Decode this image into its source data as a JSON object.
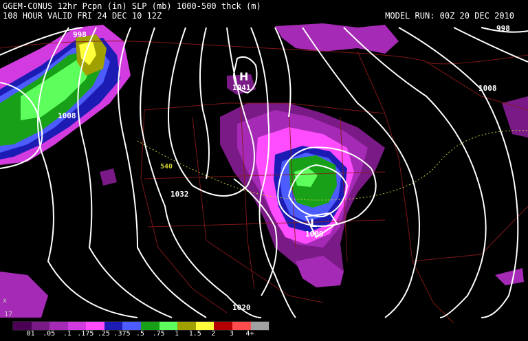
{
  "header": {
    "line1": "GGEM-CONUS 12hr Pcpn (in) SLP (mb) 1000-500 thck (m)",
    "line2": "108 HOUR VALID FRI 24 DEC 10 12Z",
    "model_run": "MODEL RUN: 00Z 20 DEC 2010"
  },
  "pressure_labels": [
    "998",
    "998",
    "1008",
    "1008",
    "1041",
    "1032",
    "1009",
    "1020"
  ],
  "thickness_label": "540",
  "centers": {
    "high": "H",
    "low": "L"
  },
  "corner_marks": {
    "x": "x",
    "number": "17"
  },
  "legend": {
    "labels": [
      "01",
      ".05",
      ".1",
      ".175",
      ".25",
      ".375",
      ".5",
      ".75",
      "1",
      "1.5",
      "2",
      "3",
      "4+"
    ],
    "colors": [
      "#4b0055",
      "#7a1a86",
      "#a52ab5",
      "#d23be0",
      "#ff4cff",
      "#1c1cb4",
      "#4c5cff",
      "#18a018",
      "#5cff5c",
      "#a0a000",
      "#ffff3c",
      "#b40000",
      "#ff4c4c",
      "#a0a0a0"
    ]
  },
  "colors": {
    "background": "#000000",
    "isobar": "#ffffff",
    "border": "#8b1a1a",
    "thickness": "#cccc33"
  }
}
